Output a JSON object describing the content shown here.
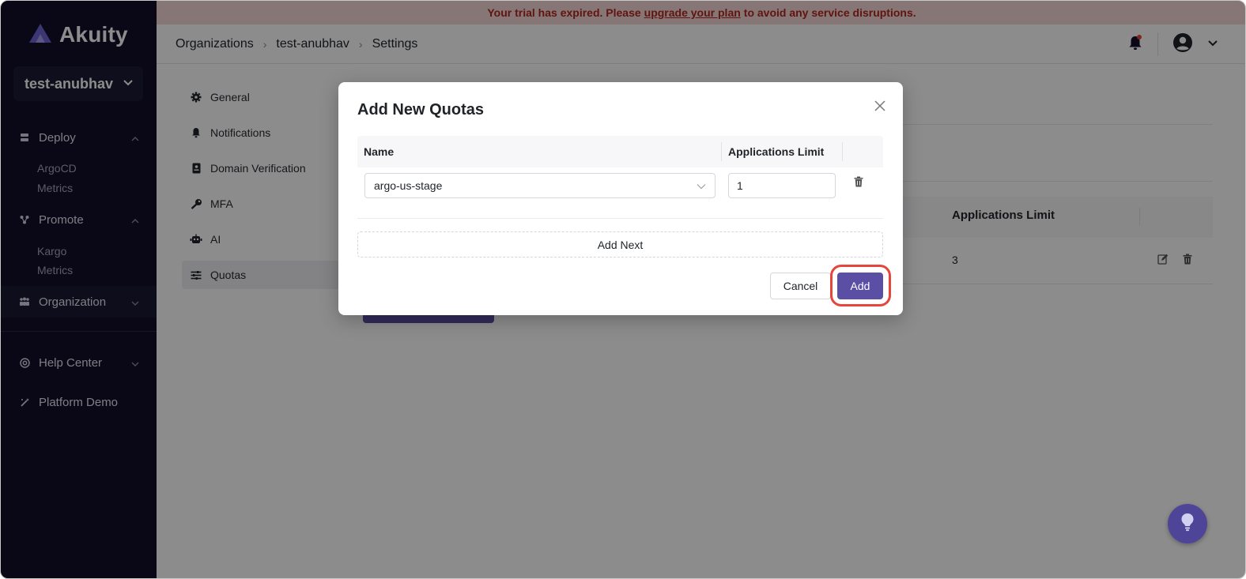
{
  "app": {
    "logo_text": "Akuity",
    "org_switcher_label": "test-anubhav"
  },
  "sidebar": {
    "groups": [
      {
        "label": "Deploy",
        "icon": "server-icon",
        "expanded": true,
        "children": [
          "ArgoCD",
          "Metrics"
        ]
      },
      {
        "label": "Promote",
        "icon": "graph-icon",
        "expanded": true,
        "children": [
          "Kargo",
          "Metrics"
        ]
      },
      {
        "label": "Organization",
        "icon": "team-icon",
        "expanded": false,
        "children": []
      },
      {
        "label": "Help Center",
        "icon": "lifebuoy-icon",
        "expanded": false,
        "children": []
      },
      {
        "label": "Platform Demo",
        "icon": "magic-wand-icon",
        "expanded": false,
        "children": []
      }
    ]
  },
  "banner": {
    "before": "Your trial has expired. Please",
    "link": "upgrade your plan",
    "after": "to avoid any service disruptions.",
    "color": "#b3261e"
  },
  "header": {
    "breadcrumb": [
      "Organizations",
      "test-anubhav",
      "Settings"
    ]
  },
  "settings_nav": {
    "items": [
      {
        "label": "General",
        "icon": "gear-icon"
      },
      {
        "label": "Notifications",
        "icon": "bell-icon"
      },
      {
        "label": "Domain Verification",
        "icon": "id-badge-icon"
      },
      {
        "label": "MFA",
        "icon": "key-icon"
      },
      {
        "label": "AI",
        "icon": "robot-icon"
      },
      {
        "label": "Quotas",
        "icon": "sliders-icon",
        "active": true
      }
    ]
  },
  "background_table": {
    "header_limit": "Applications Limit",
    "row_limit": "3"
  },
  "modal": {
    "title": "Add New Quotas",
    "col_name": "Name",
    "col_limit": "Applications Limit",
    "row": {
      "name": "argo-us-stage",
      "limit": "1"
    },
    "add_next_label": "Add Next",
    "cancel_label": "Cancel",
    "add_label": "Add"
  },
  "colors": {
    "sidebar_bg": "#131028",
    "accent": "#5b4fa5",
    "highlight": "#e5453b"
  }
}
